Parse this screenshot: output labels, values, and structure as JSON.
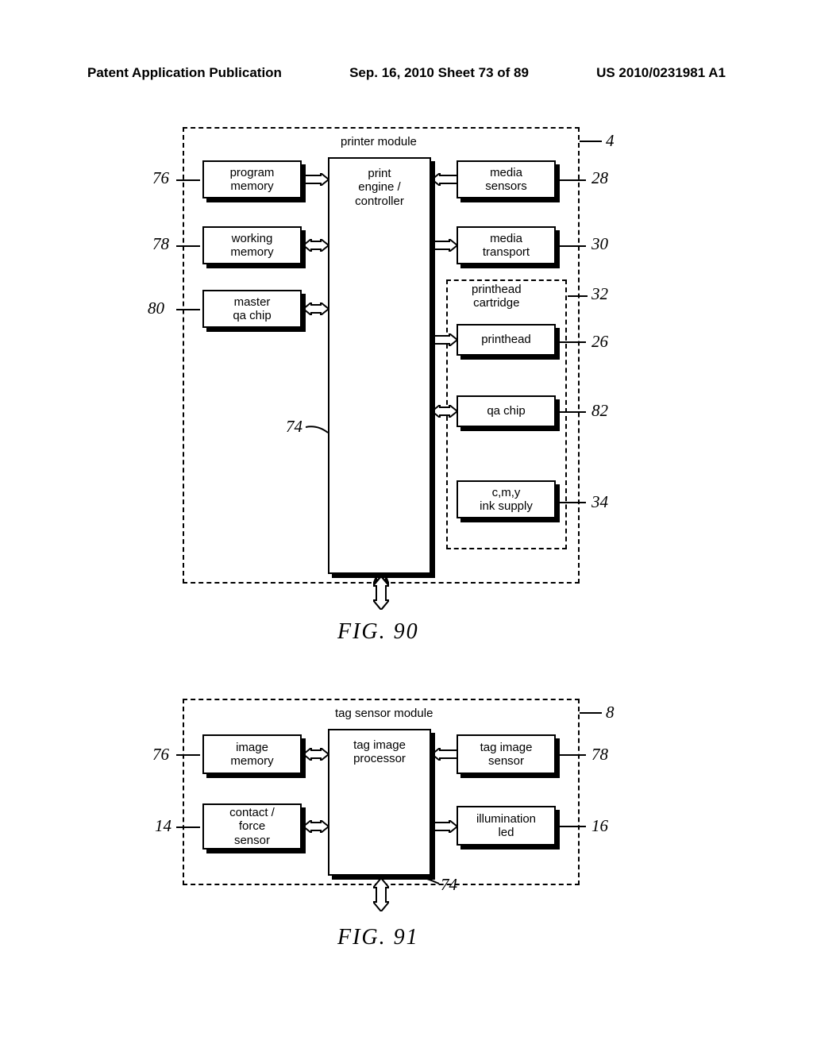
{
  "header": {
    "left": "Patent Application Publication",
    "center": "Sep. 16, 2010  Sheet 73 of 89",
    "right": "US 2010/0231981 A1"
  },
  "fig90": {
    "module_title": "printer module",
    "central": "print\nengine /\ncontroller",
    "left_boxes": {
      "program_memory": "program\nmemory",
      "working_memory": "working\nmemory",
      "master_qa_chip": "master\nqa chip"
    },
    "right_boxes": {
      "media_sensors": "media\nsensors",
      "media_transport": "media\ntransport",
      "printhead_cartridge": "printhead\ncartridge",
      "printhead": "printhead",
      "qa_chip": "qa chip",
      "ink_supply": "c,m,y\nink supply"
    },
    "refs": {
      "r4": "4",
      "r76": "76",
      "r78": "78",
      "r80": "80",
      "r74": "74",
      "r28": "28",
      "r30": "30",
      "r32": "32",
      "r26": "26",
      "r82": "82",
      "r34": "34"
    },
    "caption": "FIG. 90"
  },
  "fig91": {
    "module_title": "tag sensor module",
    "central": "tag image\nprocessor",
    "left_boxes": {
      "image_memory": "image\nmemory",
      "contact_force_sensor": "contact /\nforce\nsensor"
    },
    "right_boxes": {
      "tag_image_sensor": "tag image\nsensor",
      "illumination_led": "illumination\nled"
    },
    "refs": {
      "r8": "8",
      "r76": "76",
      "r14": "14",
      "r78": "78",
      "r16": "16",
      "r74": "74"
    },
    "caption": "FIG. 91"
  }
}
